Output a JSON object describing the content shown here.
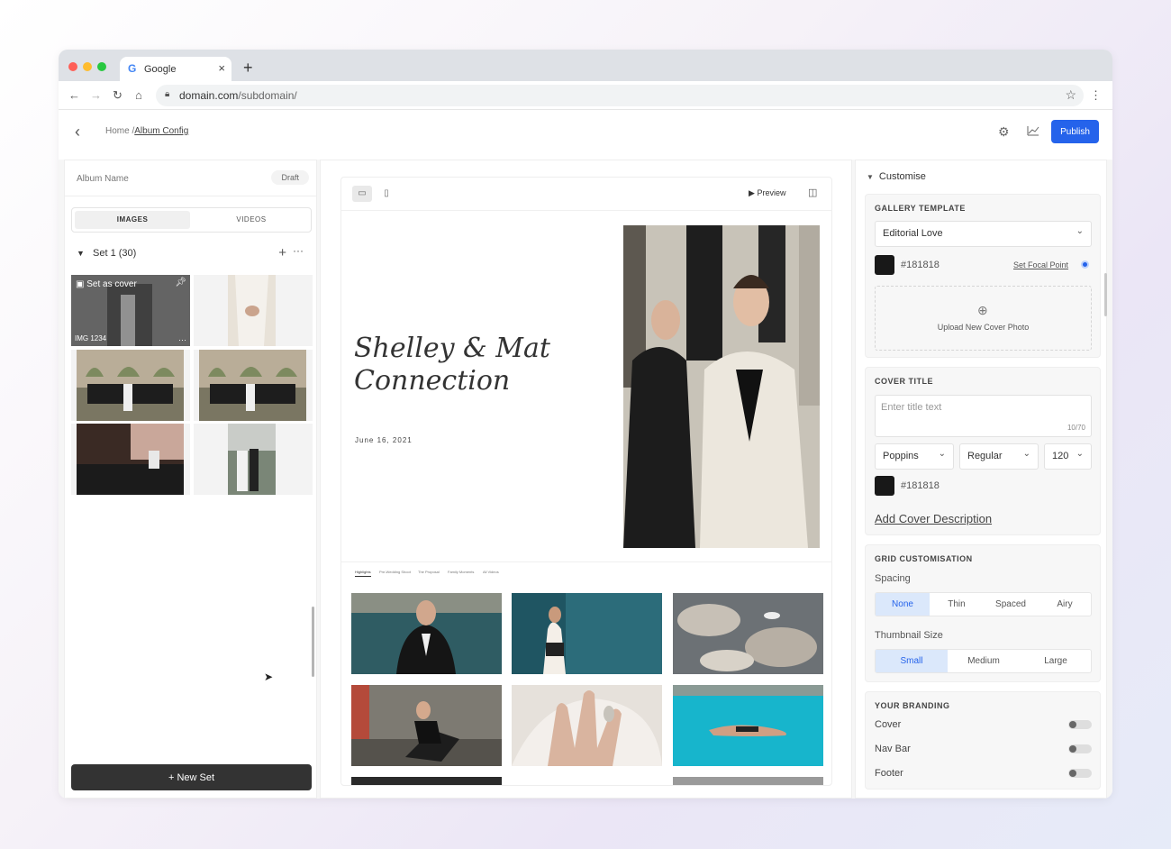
{
  "browser": {
    "tab_title": "Google",
    "url_domain": "domain.com",
    "url_path": "/subdomain/"
  },
  "header": {
    "breadcrumb_home": "Home /",
    "breadcrumb_current": "Album Config",
    "publish_label": "Publish"
  },
  "left_panel": {
    "album_name": "Album Name",
    "status": "Draft",
    "tabs": [
      "IMAGES",
      "VIDEOS"
    ],
    "set_name": "Set 1 (30)",
    "cover_label": "Set as cover",
    "cover_image_id": "IMG 1234",
    "new_set_label": "+ New Set"
  },
  "preview": {
    "preview_label": "Preview",
    "cover_title": "Shelley & Mat Connection",
    "cover_date": "June 16, 2021",
    "gallery_tabs": [
      "Highlights",
      "Pre-Wedding Shoot",
      "The Proposal",
      "Family Moments",
      "All Videos"
    ]
  },
  "customise": {
    "heading": "Customise",
    "gallery_template": {
      "title": "GALLERY TEMPLATE",
      "selected": "Editorial Love",
      "color_hex": "#181818",
      "focal_label": "Set Focal Point",
      "upload_label": "Upload  New Cover Photo"
    },
    "cover_title": {
      "title": "COVER TITLE",
      "placeholder": "Enter title text",
      "counter": "10/70",
      "font": "Poppins",
      "weight": "Regular",
      "size": "120",
      "color_hex": "#181818",
      "add_description": "Add Cover Description"
    },
    "grid": {
      "title": "GRID CUSTOMISATION",
      "spacing_label": "Spacing",
      "spacing_options": [
        "None",
        "Thin",
        "Spaced",
        "Airy"
      ],
      "thumbnail_label": "Thumbnail Size",
      "thumbnail_options": [
        "Small",
        "Medium",
        "Large"
      ]
    },
    "branding": {
      "title": "YOUR BRANDING",
      "items": [
        "Cover",
        "Nav Bar",
        "Footer"
      ]
    }
  },
  "colors": {
    "accent": "#2563eb",
    "swatch": "#181818",
    "new_set_bg": "#333333"
  }
}
